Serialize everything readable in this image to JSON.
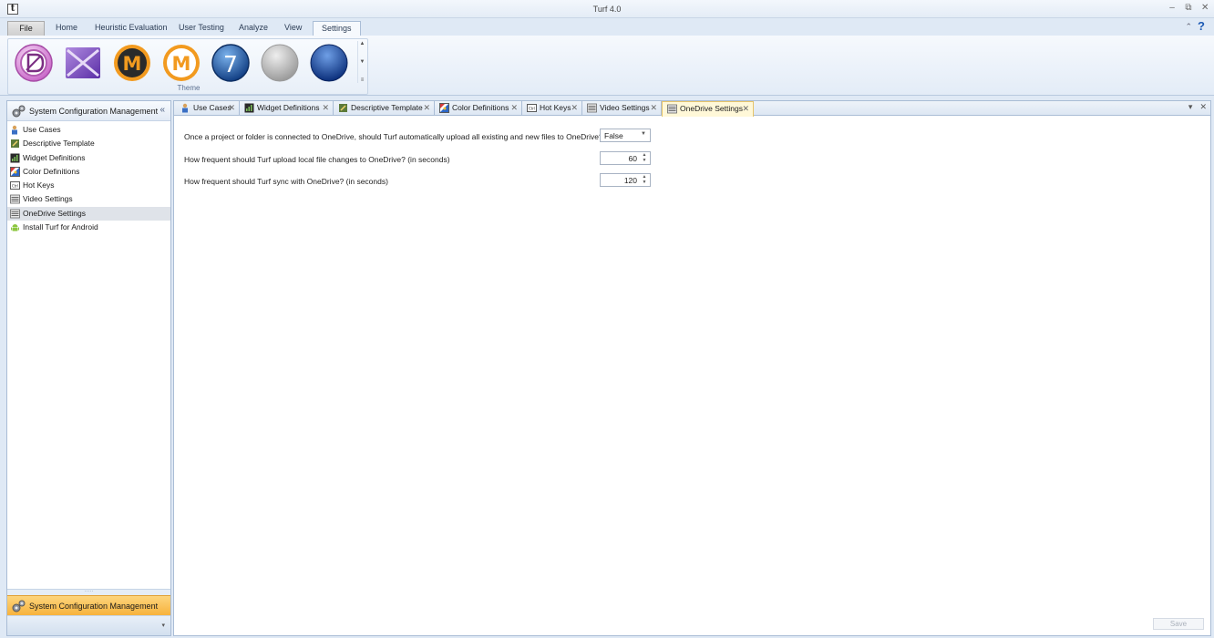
{
  "window": {
    "title": "Turf 4.0",
    "app_icon_letter": "t"
  },
  "window_controls": {
    "minimize": "–",
    "restore": "⧉",
    "close": "✕"
  },
  "ribbon": {
    "tabs": [
      "File",
      "Home",
      "Heuristic Evaluation",
      "User Testing",
      "Analyze",
      "View",
      "Settings"
    ],
    "active_tab": "Settings",
    "group_label": "Theme",
    "help": "?",
    "collapse": "⌃"
  },
  "left_panel": {
    "header": "System Configuration Management",
    "collapse_glyph": "«",
    "items": [
      {
        "label": "Use Cases",
        "icon": "use-cases-icon"
      },
      {
        "label": "Descriptive Template",
        "icon": "template-icon"
      },
      {
        "label": "Widget Definitions",
        "icon": "widget-icon"
      },
      {
        "label": "Color Definitions",
        "icon": "color-icon"
      },
      {
        "label": "Hot Keys",
        "icon": "keyboard-icon"
      },
      {
        "label": "Video Settings",
        "icon": "video-icon"
      },
      {
        "label": "OneDrive Settings",
        "icon": "onedrive-icon"
      },
      {
        "label": "Install Turf for Android",
        "icon": "android-icon"
      }
    ],
    "selected_index": 6,
    "splitter": "·····",
    "footer_active": "System Configuration Management",
    "footer_more": "▾"
  },
  "doc_tabs": [
    {
      "label": "Use Cases"
    },
    {
      "label": "Widget Definitions"
    },
    {
      "label": "Descriptive Template"
    },
    {
      "label": "Color Definitions"
    },
    {
      "label": "Hot Keys"
    },
    {
      "label": "Video Settings"
    },
    {
      "label": "OneDrive Settings"
    }
  ],
  "doc_tools": {
    "dropdown": "▾",
    "close": "✕"
  },
  "tab_close_glyph": "✕",
  "settings": {
    "upload_question": "Once a project or folder is connected to OneDrive, should Turf automatically upload all existing and new files to OneDrive?",
    "upload_value": "False",
    "upload_freq_question": "How frequent should Turf upload local file changes to OneDrive? (in seconds)",
    "upload_freq_value": "60",
    "sync_freq_question": "How frequent should Turf sync with OneDrive? (in seconds)",
    "sync_freq_value": "120"
  },
  "save_label": "Save",
  "colors": {
    "accent_orange": "#f7b23c",
    "ribbon_blue": "#dfe9f5",
    "active_tab": "#fff8d8"
  }
}
